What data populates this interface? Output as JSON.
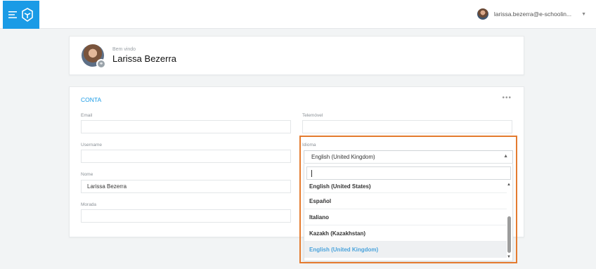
{
  "topbar": {
    "user_email": "larissa.bezerra@e-schoolin...",
    "menu_icon": "hamburger-icon",
    "logo_icon": "app-logo-icon"
  },
  "profile": {
    "welcome": "Bem vindo",
    "name": "Larissa Bezerra",
    "edit_icon": "link-icon"
  },
  "account": {
    "title": "CONTA",
    "more": "•••",
    "fields": {
      "email_label": "Email",
      "email_value": "",
      "username_label": "Username",
      "username_value": "",
      "nome_label": "Nome",
      "nome_value": "Larissa Bezerra",
      "morada_label": "Morada",
      "morada_value": "",
      "telemovel_label": "Telemóvel",
      "telemovel_value": "",
      "idioma_label": "Idioma",
      "idioma_value": "English (United Kingdom)"
    }
  },
  "dropdown": {
    "search_value": "",
    "options": [
      "English (United States)",
      "Español",
      "Italiano",
      "Kazakh (Kazakhstan)",
      "English (United Kingdom)"
    ],
    "selected_index": 4
  },
  "colors": {
    "accent": "#1a9be6",
    "highlight": "#e47b2f",
    "selected_option": "#4aa3dc"
  }
}
